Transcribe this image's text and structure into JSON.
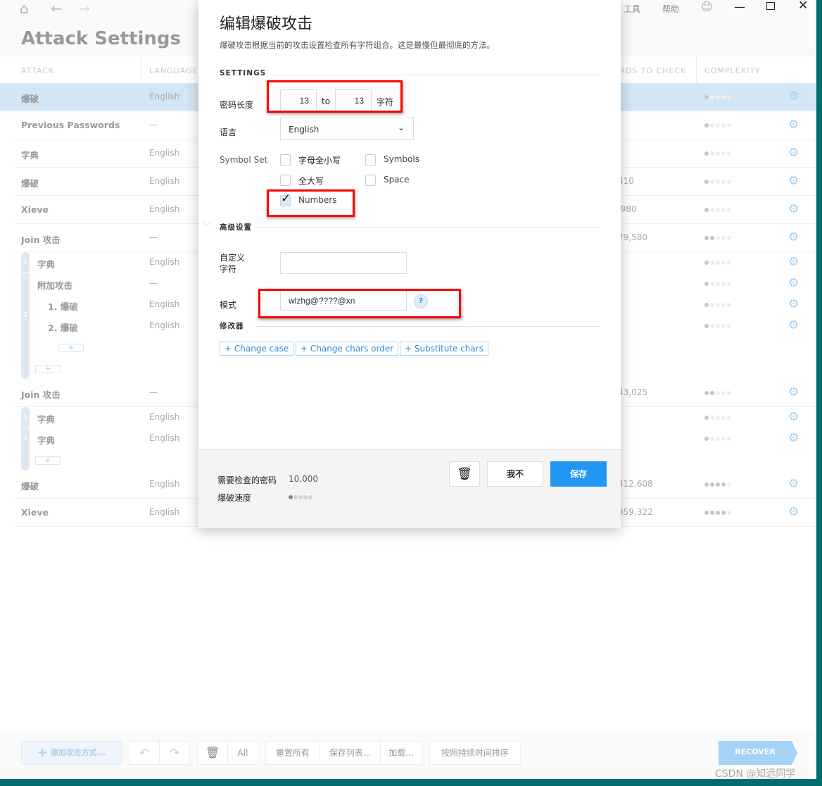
{
  "app": {
    "title": "Attack Settings",
    "menu": [
      "工具",
      "帮助"
    ]
  },
  "colors": {
    "accent": "#2196f3",
    "selected_row": "#d3e6f6",
    "frame": "#006e6e",
    "highlight": "#ff0000"
  },
  "columns": {
    "attack": "ATTACK",
    "language": "LANGUAGE",
    "passwords": "RDS TO CHECK",
    "complexity": "COMPLEXITY"
  },
  "rows": [
    {
      "name": "爆破",
      "lang": "English",
      "num": "",
      "complexity": 1,
      "selected": true
    },
    {
      "name": "Previous Passwords",
      "lang": "—",
      "num": "",
      "complexity": 1
    },
    {
      "name": "字典",
      "lang": "English",
      "num": "",
      "complexity": 1
    },
    {
      "name": "爆破",
      "lang": "English",
      "num": "410",
      "complexity": 1
    },
    {
      "name": "Xieve",
      "lang": "English",
      "num": ",980",
      "complexity": 1
    },
    {
      "name": "Join 攻击",
      "lang": "—",
      "num": "79,580",
      "complexity": 2
    },
    {
      "name": "字典",
      "lang": "English",
      "num": "",
      "complexity": 1,
      "indent": 1
    },
    {
      "name": "附加攻击",
      "lang": "—",
      "num": "",
      "complexity": 1,
      "indent": 1
    },
    {
      "name": "1. 爆破",
      "lang": "English",
      "num": "",
      "complexity": 1,
      "indent": 2
    },
    {
      "name": "2. 爆破",
      "lang": "English",
      "num": "",
      "complexity": 1,
      "indent": 2
    },
    {
      "name": "Join 攻击",
      "lang": "—",
      "num": "43,025",
      "complexity": 2
    },
    {
      "name": "字典",
      "lang": "English",
      "num": "",
      "complexity": 1,
      "indent": 1
    },
    {
      "name": "字典",
      "lang": "English",
      "num": "",
      "complexity": 1,
      "indent": 1
    },
    {
      "name": "爆破",
      "lang": "English",
      "num": "412,608",
      "complexity": 4
    },
    {
      "name": "Xieve",
      "lang": "English",
      "num": "959,322",
      "complexity": 4
    }
  ],
  "rails": [
    "1",
    "2",
    "1",
    "2"
  ],
  "modal": {
    "title": "编辑爆破攻击",
    "description": "爆破攻击根据当前的攻击设置检查所有字符组合。这是最慢但最彻底的方法。",
    "settings_label": "SETTINGS",
    "length_label": "密码长度",
    "length_from": "13",
    "length_to_word": "to",
    "length_to": "13",
    "length_unit": "字符",
    "language_label": "语言",
    "language_value": "English",
    "symbol_set_label": "Symbol Set",
    "symbols": [
      {
        "label": "字母全小写",
        "checked": false
      },
      {
        "label": "Symbols",
        "checked": false
      },
      {
        "label": "全大写",
        "checked": false
      },
      {
        "label": "Space",
        "checked": false
      },
      {
        "label": "Numbers",
        "checked": true
      }
    ],
    "advanced_label": "高级设置",
    "custom_chars_label": "自定义字符",
    "custom_chars_value": "",
    "mask_label": "模式",
    "mask_value": "wlzhg@????@xn",
    "help": "?",
    "modifiers_label": "修改器",
    "modifiers": [
      "+ Change case",
      "+ Change chars order",
      "+ Substitute chars"
    ],
    "passwords_label": "需要检查的密码",
    "passwords_value": "10,000",
    "speed_label": "爆破速度",
    "speed": 1,
    "cancel": "我不",
    "save": "保存"
  },
  "toolbar": {
    "add": "添加攻击方式...",
    "all": "All",
    "reset": "重置所有",
    "save_list": "保存列表...",
    "load": "加载...",
    "sort": "按照持续时间排序",
    "recover": "RECOVER"
  },
  "watermark": "CSDN @知远同学"
}
